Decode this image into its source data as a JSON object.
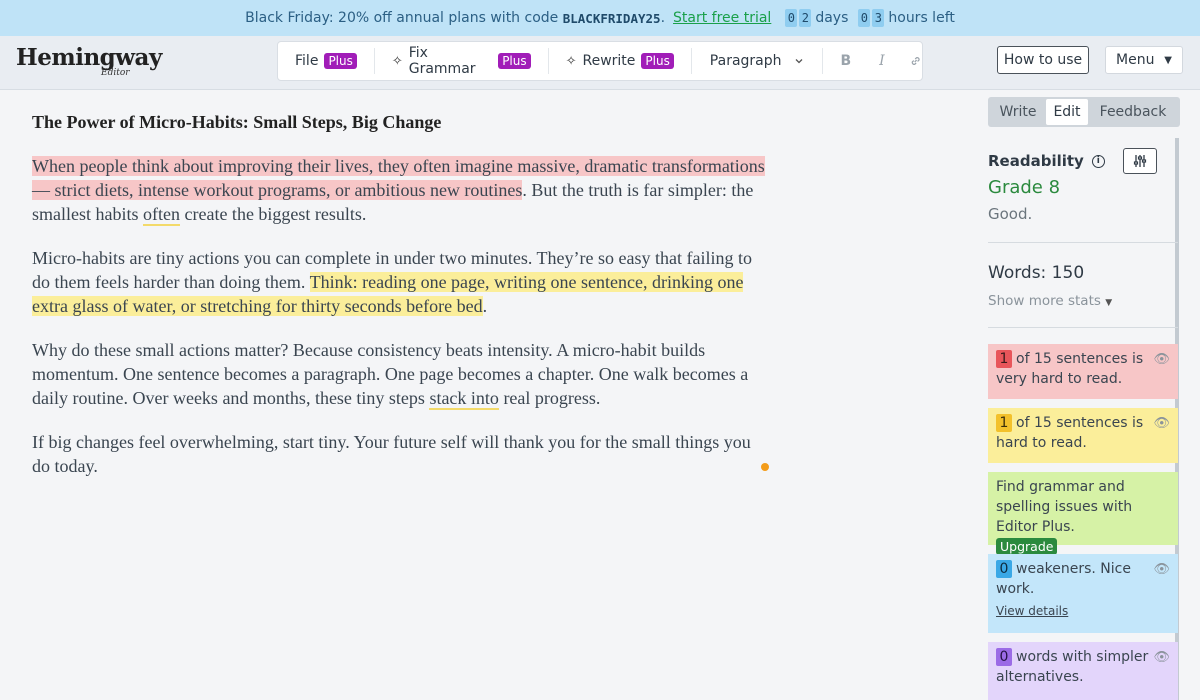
{
  "promo": {
    "text": "Black Friday: 20% off annual plans with code",
    "code": "BLACKFRIDAY25",
    "period": ".",
    "trial_link": "Start free trial",
    "days_digits": [
      "0",
      "2"
    ],
    "days_label": "days",
    "hours_digits": [
      "0",
      "3"
    ],
    "hours_label": "hours left"
  },
  "header": {
    "logo": "Hemingway",
    "logo_sub": "Editor",
    "toolbar": {
      "file": "File",
      "fix_grammar": "Fix Grammar",
      "rewrite": "Rewrite",
      "plus_badge": "Plus",
      "paragraph": "Paragraph",
      "bold": "B",
      "italic": "I"
    },
    "how_to_use": "How to use",
    "menu": "Menu"
  },
  "editor": {
    "title": "The Power of Micro-Habits: Small Steps, Big Change",
    "p1": {
      "red": "When people think about improving their lives, they often imagine massive, dramatic transformations — strict diets, intense workout programs, or ambitious new routines",
      "rest1": ". But the truth is far simpler: the smallest habits ",
      "under": "often",
      "rest2": " create the biggest results."
    },
    "p2": {
      "plain": "Micro-habits are tiny actions you can complete in under two minutes. They’re so easy that failing to do them feels harder than doing them. ",
      "yellow": "Think: reading one page, writing one sentence, drinking one extra glass of water, or stretching for thirty seconds before bed",
      "end": "."
    },
    "p3": {
      "plain": "Why do these small actions matter? Because consistency beats intensity. A micro-habit builds momentum. One sentence becomes a paragraph. One page becomes a chapter. One walk becomes a daily routine. Over weeks and months, these tiny steps ",
      "under": "stack into",
      "end": " real progress."
    },
    "p4": "If big changes feel overwhelming, start tiny. Your future self will thank you for the small things you do today."
  },
  "sidebar": {
    "tabs": [
      "Write",
      "Edit",
      "Feedback"
    ],
    "readability_label": "Readability",
    "grade": "Grade 8",
    "grade_note": "Good.",
    "words": "Words: 150",
    "show_more": "Show more stats",
    "cards": {
      "very_hard": {
        "count": "1",
        "text": "of 15 sentences is very hard to read."
      },
      "hard": {
        "count": "1",
        "text": "of 15 sentences is hard to read."
      },
      "grammar": {
        "text": "Find grammar and spelling issues with Editor Plus.",
        "button": "Upgrade"
      },
      "weakeners": {
        "count": "0",
        "text": "weakeners. Nice work.",
        "link": "View details"
      },
      "simpler": {
        "count": "0",
        "text": "words with simpler alternatives."
      }
    }
  },
  "colors": {
    "red_highlight": "#f7c6c7",
    "yellow_highlight": "#fbee9a",
    "plus_badge": "#a11db8",
    "grade_green": "#2b8a3e"
  }
}
